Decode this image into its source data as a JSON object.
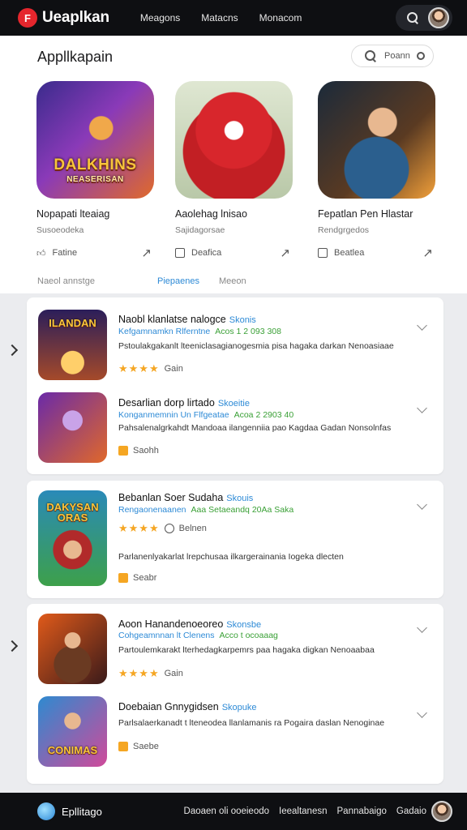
{
  "topbar": {
    "logo_mark": "F",
    "brand": "Ueaplkan",
    "nav": [
      "Meagons",
      "Matacns",
      "Monacom"
    ]
  },
  "panel": {
    "title": "Appllkapain",
    "search_placeholder": "Poann"
  },
  "featured": [
    {
      "name": "Nopapati lteaiag",
      "sub": "Susoeodeka",
      "action": "Fatine",
      "banner": "DALKHINS",
      "banner_sub": "NEASERISAN"
    },
    {
      "name": "Aaolehag lnisao",
      "sub": "Sajidagorsae",
      "action": "Deafica"
    },
    {
      "name": "Fepatlan Pen Hlastar",
      "sub": "Rendgrgedos",
      "action": "Beatlea"
    }
  ],
  "tabs": [
    "Naeol annstge",
    "Piepaenes",
    "Meeon"
  ],
  "list_groups": [
    {
      "rows": [
        {
          "title": "Naobl klanlatse nalogce",
          "tag": "Skonis",
          "developer": "Kefgamnamkn Rlferntne",
          "count": "Acos 1 2 093 308",
          "desc": "Pstoulakgakanlt lteeniclasagianogesmia pisa hagaka darkan Nenoasiaae",
          "rating_stars": "★★★★",
          "rating_label": "Gain",
          "banner": "ILANDAN"
        },
        {
          "title": "Desarlian dorp lirtado",
          "tag": "Skoeitie",
          "developer": "Konganmemnin Un Flfgeatae",
          "count": "Acoa 2 2903 40",
          "desc": "Pahsalenalgrkahdt Mandoaa ilangenniia pao Kagdaa Gadan Nonsolnfas",
          "badge_label": "Saohh"
        }
      ]
    },
    {
      "rows": [
        {
          "title": "Bebanlan Soer Sudaha",
          "tag": "Skouis",
          "developer": "Rengaonenaanen",
          "count": "Aaa Setaeandq 20Aa Saka",
          "rating_stars": "★★★★",
          "rating_label": "Belnen",
          "desc": "Parlanenlyakarlat lrepchusaa ilkargerainania Iogeka dlecten",
          "badge_label": "Seabr",
          "banner": "DAKYSAN",
          "banner_sub": "ORAS"
        }
      ]
    },
    {
      "rows": [
        {
          "title": "Aoon Hanandenoeoreo",
          "tag": "Skonsbe",
          "developer": "Cohgeamnnan lt Clenens",
          "count": "Acco t ocoaaag",
          "desc": "Partoulemkarakt lterhedagkarpemrs paa hagaka digkan Nenoaabaa",
          "rating_stars": "★★★★",
          "rating_label": "Gain"
        },
        {
          "title": "Doebaian Gnnygidsen",
          "tag": "Skopuke",
          "desc": "Parlsalaerkanadt t lteneodea llanlamanis ra Pogaira daslan Nenoginae",
          "badge_label": "Saebe",
          "banner": "CONIMAS"
        }
      ]
    }
  ],
  "bottombar": {
    "brand": "Epllitago",
    "links": [
      "Daoaen oli ooeieodo",
      "Ieealtanesn",
      "Pannabaigo",
      "Gadaio"
    ]
  },
  "colors": {
    "accent": "#2d8ad6",
    "stars": "#f5a623",
    "bar": "#0e0f12"
  }
}
